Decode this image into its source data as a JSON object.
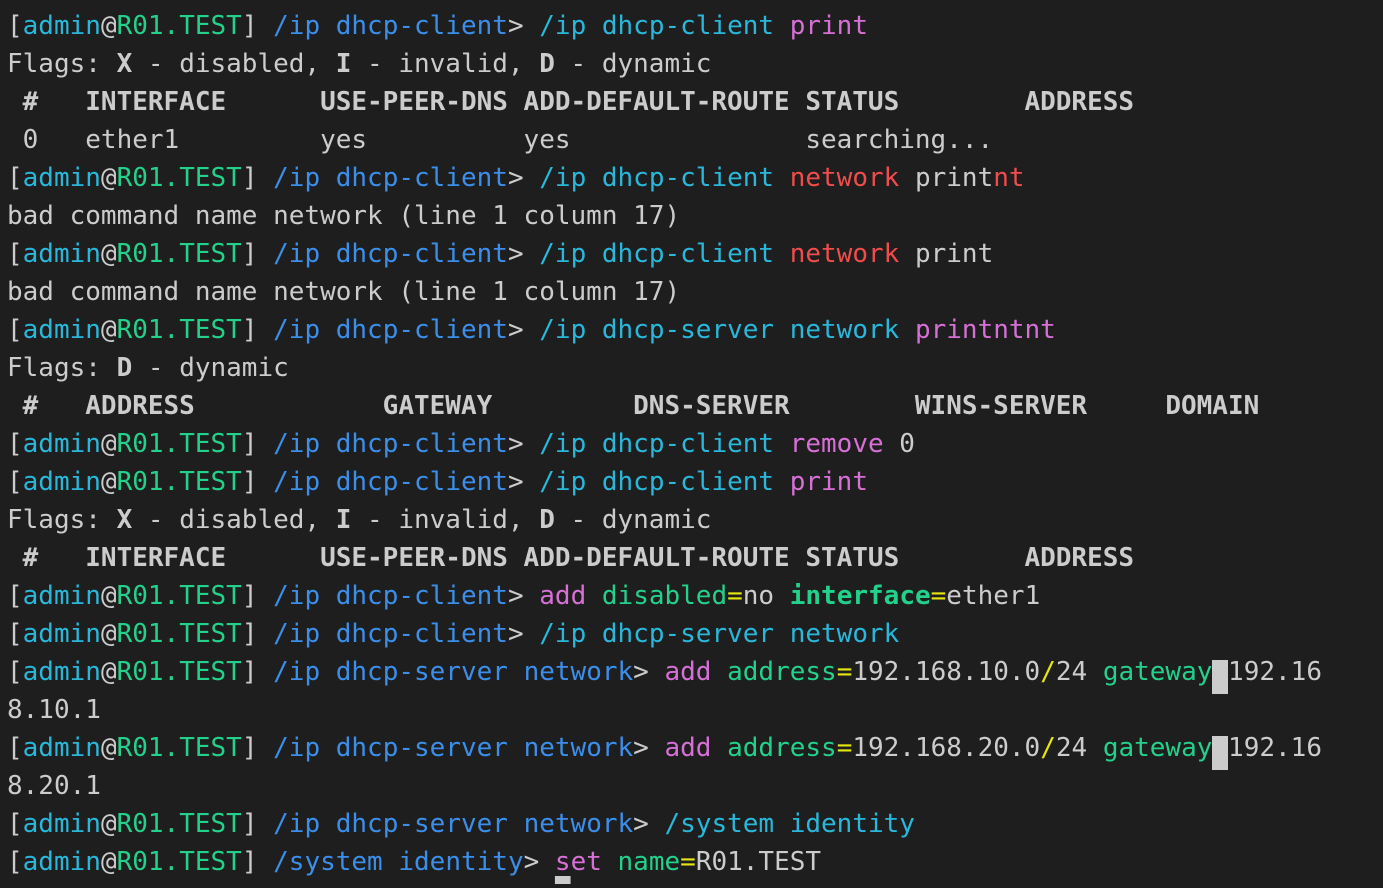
{
  "colors": {
    "background": "#1e1e1e",
    "default_text": "#cccccc",
    "user": "#29b8db",
    "at": "#cccccc",
    "host": "#23d18b",
    "path": "#3b8eea",
    "command_keyword": "#d670d6",
    "argument_name": "#23d18b",
    "error": "#f14c4c",
    "value_path": "#29b8db",
    "bracket": "#cccccc",
    "slash_separator": "#e5e510"
  },
  "terminal": {
    "lines": [
      {
        "segments": [
          {
            "text": "[",
            "color": "#cccccc"
          },
          {
            "text": "admin",
            "color": "#29b8db"
          },
          {
            "text": "@",
            "color": "#cccccc"
          },
          {
            "text": "R01.TEST",
            "color": "#23d18b"
          },
          {
            "text": "] ",
            "color": "#cccccc"
          },
          {
            "text": "/ip dhcp-client",
            "color": "#3b8eea"
          },
          {
            "text": "> ",
            "color": "#cccccc"
          },
          {
            "text": "/ip dhcp-client ",
            "color": "#29b8db"
          },
          {
            "text": "print",
            "color": "#d670d6"
          }
        ]
      },
      {
        "segments": [
          {
            "text": "Flags: ",
            "color": "#cccccc"
          },
          {
            "text": "X",
            "color": "#cccccc",
            "bold": true
          },
          {
            "text": " - disabled, ",
            "color": "#cccccc"
          },
          {
            "text": "I",
            "color": "#cccccc",
            "bold": true
          },
          {
            "text": " - invalid, ",
            "color": "#cccccc"
          },
          {
            "text": "D",
            "color": "#cccccc",
            "bold": true
          },
          {
            "text": " - dynamic",
            "color": "#cccccc"
          }
        ]
      },
      {
        "segments": [
          {
            "text": " #   INTERFACE      USE-PEER-DNS ADD-DEFAULT-ROUTE STATUS        ADDRESS",
            "color": "#cccccc",
            "bold": true
          }
        ]
      },
      {
        "segments": [
          {
            "text": " 0   ether1         yes          yes               searching...",
            "color": "#cccccc"
          }
        ]
      },
      {
        "segments": [
          {
            "text": "[",
            "color": "#cccccc"
          },
          {
            "text": "admin",
            "color": "#29b8db"
          },
          {
            "text": "@",
            "color": "#cccccc"
          },
          {
            "text": "R01.TEST",
            "color": "#23d18b"
          },
          {
            "text": "] ",
            "color": "#cccccc"
          },
          {
            "text": "/ip dhcp-client",
            "color": "#3b8eea"
          },
          {
            "text": "> ",
            "color": "#cccccc"
          },
          {
            "text": "/ip dhcp-client ",
            "color": "#29b8db"
          },
          {
            "text": "network",
            "color": "#f14c4c"
          },
          {
            "text": " print",
            "color": "#cccccc"
          },
          {
            "text": "nt",
            "color": "#f14c4c"
          }
        ]
      },
      {
        "segments": [
          {
            "text": "bad command name network (line 1 column 17)",
            "color": "#cccccc"
          }
        ]
      },
      {
        "segments": [
          {
            "text": "[",
            "color": "#cccccc"
          },
          {
            "text": "admin",
            "color": "#29b8db"
          },
          {
            "text": "@",
            "color": "#cccccc"
          },
          {
            "text": "R01.TEST",
            "color": "#23d18b"
          },
          {
            "text": "] ",
            "color": "#cccccc"
          },
          {
            "text": "/ip dhcp-client",
            "color": "#3b8eea"
          },
          {
            "text": "> ",
            "color": "#cccccc"
          },
          {
            "text": "/ip dhcp-client ",
            "color": "#29b8db"
          },
          {
            "text": "network",
            "color": "#f14c4c"
          },
          {
            "text": " print",
            "color": "#cccccc"
          }
        ]
      },
      {
        "segments": [
          {
            "text": "bad command name network (line 1 column 17)",
            "color": "#cccccc"
          }
        ]
      },
      {
        "segments": [
          {
            "text": "[",
            "color": "#cccccc"
          },
          {
            "text": "admin",
            "color": "#29b8db"
          },
          {
            "text": "@",
            "color": "#cccccc"
          },
          {
            "text": "R01.TEST",
            "color": "#23d18b"
          },
          {
            "text": "] ",
            "color": "#cccccc"
          },
          {
            "text": "/ip dhcp-client",
            "color": "#3b8eea"
          },
          {
            "text": "> ",
            "color": "#cccccc"
          },
          {
            "text": "/ip dhcp-server network ",
            "color": "#29b8db"
          },
          {
            "text": "printntnt",
            "color": "#d670d6"
          }
        ]
      },
      {
        "segments": [
          {
            "text": "Flags: ",
            "color": "#cccccc"
          },
          {
            "text": "D",
            "color": "#cccccc",
            "bold": true
          },
          {
            "text": " - dynamic",
            "color": "#cccccc"
          }
        ]
      },
      {
        "segments": [
          {
            "text": " #   ADDRESS            GATEWAY         DNS-SERVER        WINS-SERVER     DOMAIN",
            "color": "#cccccc",
            "bold": true
          }
        ]
      },
      {
        "segments": [
          {
            "text": "[",
            "color": "#cccccc"
          },
          {
            "text": "admin",
            "color": "#29b8db"
          },
          {
            "text": "@",
            "color": "#cccccc"
          },
          {
            "text": "R01.TEST",
            "color": "#23d18b"
          },
          {
            "text": "] ",
            "color": "#cccccc"
          },
          {
            "text": "/ip dhcp-client",
            "color": "#3b8eea"
          },
          {
            "text": "> ",
            "color": "#cccccc"
          },
          {
            "text": "/ip dhcp-client ",
            "color": "#29b8db"
          },
          {
            "text": "remove",
            "color": "#d670d6"
          },
          {
            "text": " 0",
            "color": "#cccccc"
          }
        ]
      },
      {
        "segments": [
          {
            "text": "[",
            "color": "#cccccc"
          },
          {
            "text": "admin",
            "color": "#29b8db"
          },
          {
            "text": "@",
            "color": "#cccccc"
          },
          {
            "text": "R01.TEST",
            "color": "#23d18b"
          },
          {
            "text": "] ",
            "color": "#cccccc"
          },
          {
            "text": "/ip dhcp-client",
            "color": "#3b8eea"
          },
          {
            "text": "> ",
            "color": "#cccccc"
          },
          {
            "text": "/ip dhcp-client ",
            "color": "#29b8db"
          },
          {
            "text": "print",
            "color": "#d670d6"
          }
        ]
      },
      {
        "segments": [
          {
            "text": "Flags: ",
            "color": "#cccccc"
          },
          {
            "text": "X",
            "color": "#cccccc",
            "bold": true
          },
          {
            "text": " - disabled, ",
            "color": "#cccccc"
          },
          {
            "text": "I",
            "color": "#cccccc",
            "bold": true
          },
          {
            "text": " - invalid, ",
            "color": "#cccccc"
          },
          {
            "text": "D",
            "color": "#cccccc",
            "bold": true
          },
          {
            "text": " - dynamic",
            "color": "#cccccc"
          }
        ]
      },
      {
        "segments": [
          {
            "text": " #   INTERFACE      USE-PEER-DNS ADD-DEFAULT-ROUTE STATUS        ADDRESS",
            "color": "#cccccc",
            "bold": true
          }
        ]
      },
      {
        "segments": [
          {
            "text": "[",
            "color": "#cccccc"
          },
          {
            "text": "admin",
            "color": "#29b8db"
          },
          {
            "text": "@",
            "color": "#cccccc"
          },
          {
            "text": "R01.TEST",
            "color": "#23d18b"
          },
          {
            "text": "] ",
            "color": "#cccccc"
          },
          {
            "text": "/ip dhcp-client",
            "color": "#3b8eea"
          },
          {
            "text": "> ",
            "color": "#cccccc"
          },
          {
            "text": "add",
            "color": "#d670d6"
          },
          {
            "text": " ",
            "color": "#cccccc"
          },
          {
            "text": "disabled",
            "color": "#23d18b"
          },
          {
            "text": "=",
            "color": "#e5e510"
          },
          {
            "text": "no",
            "color": "#cccccc"
          },
          {
            "text": " ",
            "color": "#cccccc"
          },
          {
            "text": "interface",
            "color": "#23d18b",
            "bold": true
          },
          {
            "text": "=",
            "color": "#e5e510"
          },
          {
            "text": "ether1",
            "color": "#cccccc"
          }
        ]
      },
      {
        "segments": [
          {
            "text": "[",
            "color": "#cccccc"
          },
          {
            "text": "admin",
            "color": "#29b8db"
          },
          {
            "text": "@",
            "color": "#cccccc"
          },
          {
            "text": "R01.TEST",
            "color": "#23d18b"
          },
          {
            "text": "] ",
            "color": "#cccccc"
          },
          {
            "text": "/ip dhcp-client",
            "color": "#3b8eea"
          },
          {
            "text": "> ",
            "color": "#cccccc"
          },
          {
            "text": "/ip dhcp-server network",
            "color": "#29b8db"
          }
        ]
      },
      {
        "segments": [
          {
            "text": "[",
            "color": "#cccccc"
          },
          {
            "text": "admin",
            "color": "#29b8db"
          },
          {
            "text": "@",
            "color": "#cccccc"
          },
          {
            "text": "R01.TEST",
            "color": "#23d18b"
          },
          {
            "text": "] ",
            "color": "#cccccc"
          },
          {
            "text": "/ip dhcp-server network",
            "color": "#3b8eea"
          },
          {
            "text": "> ",
            "color": "#cccccc"
          },
          {
            "text": "add",
            "color": "#d670d6"
          },
          {
            "text": " ",
            "color": "#cccccc"
          },
          {
            "text": "address",
            "color": "#23d18b"
          },
          {
            "text": "=",
            "color": "#e5e510"
          },
          {
            "text": "192.168.10.0",
            "color": "#cccccc"
          },
          {
            "text": "/",
            "color": "#e5e510"
          },
          {
            "text": "24",
            "color": "#cccccc"
          },
          {
            "text": " ",
            "color": "#cccccc"
          },
          {
            "text": "gateway",
            "color": "#23d18b"
          },
          {
            "text": "=",
            "color": "#cccccc",
            "cursor": true
          },
          {
            "text": "192.16",
            "color": "#cccccc"
          }
        ]
      },
      {
        "segments": [
          {
            "text": "8.10.1",
            "color": "#cccccc"
          }
        ]
      },
      {
        "segments": [
          {
            "text": "[",
            "color": "#cccccc"
          },
          {
            "text": "admin",
            "color": "#29b8db"
          },
          {
            "text": "@",
            "color": "#cccccc"
          },
          {
            "text": "R01.TEST",
            "color": "#23d18b"
          },
          {
            "text": "] ",
            "color": "#cccccc"
          },
          {
            "text": "/ip dhcp-server network",
            "color": "#3b8eea"
          },
          {
            "text": "> ",
            "color": "#cccccc"
          },
          {
            "text": "add",
            "color": "#d670d6"
          },
          {
            "text": " ",
            "color": "#cccccc"
          },
          {
            "text": "address",
            "color": "#23d18b"
          },
          {
            "text": "=",
            "color": "#e5e510"
          },
          {
            "text": "192.168.20.0",
            "color": "#cccccc"
          },
          {
            "text": "/",
            "color": "#e5e510"
          },
          {
            "text": "24",
            "color": "#cccccc"
          },
          {
            "text": " ",
            "color": "#cccccc"
          },
          {
            "text": "gateway",
            "color": "#23d18b"
          },
          {
            "text": "=",
            "color": "#cccccc",
            "cursor": true
          },
          {
            "text": "192.16",
            "color": "#cccccc"
          }
        ]
      },
      {
        "segments": [
          {
            "text": "8.20.1",
            "color": "#cccccc"
          }
        ]
      },
      {
        "segments": [
          {
            "text": "[",
            "color": "#cccccc"
          },
          {
            "text": "admin",
            "color": "#29b8db"
          },
          {
            "text": "@",
            "color": "#cccccc"
          },
          {
            "text": "R01.TEST",
            "color": "#23d18b"
          },
          {
            "text": "] ",
            "color": "#cccccc"
          },
          {
            "text": "/ip dhcp-server network",
            "color": "#3b8eea"
          },
          {
            "text": "> ",
            "color": "#cccccc"
          },
          {
            "text": "/system identity",
            "color": "#29b8db"
          }
        ]
      },
      {
        "segments": [
          {
            "text": "[",
            "color": "#cccccc"
          },
          {
            "text": "admin",
            "color": "#29b8db"
          },
          {
            "text": "@",
            "color": "#cccccc"
          },
          {
            "text": "R01.TEST",
            "color": "#23d18b"
          },
          {
            "text": "] ",
            "color": "#cccccc"
          },
          {
            "text": "/system identity",
            "color": "#3b8eea"
          },
          {
            "text": "> ",
            "color": "#cccccc"
          },
          {
            "text": "set",
            "color": "#d670d6",
            "cursor_under_first": true
          },
          {
            "text": " ",
            "color": "#cccccc"
          },
          {
            "text": "name",
            "color": "#23d18b"
          },
          {
            "text": "=",
            "color": "#e5e510"
          },
          {
            "text": "R01.TEST",
            "color": "#cccccc"
          }
        ]
      }
    ]
  }
}
